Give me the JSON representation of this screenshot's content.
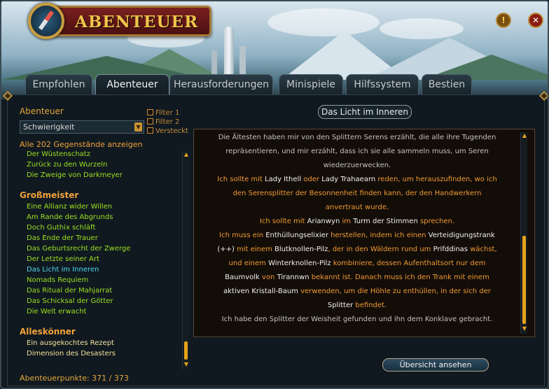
{
  "window": {
    "title": "ABENTEUER",
    "info_icon": "info-icon",
    "close_icon": "close-icon"
  },
  "tabs": [
    {
      "label": "Empfohlen",
      "active": false
    },
    {
      "label": "Abenteuer",
      "active": true
    },
    {
      "label": "Herausforderungen",
      "active": false
    },
    {
      "label": "Minispiele",
      "active": false
    },
    {
      "label": "Hilfssystem",
      "active": false
    },
    {
      "label": "Bestien",
      "active": false
    }
  ],
  "sidebar": {
    "section_title": "Abenteuer",
    "sort_dropdown": {
      "selected": "Schwierigkeit"
    },
    "filters": [
      {
        "label": "Filter 1",
        "checked": false
      },
      {
        "label": "Filter 2",
        "checked": false
      },
      {
        "label": "Versteckt",
        "checked": false
      }
    ],
    "show_all_label": "Alle 202 Gegenstände anzeigen",
    "items_top": [
      "Der Wüstenschatz",
      "Zurück zu den Wurzeln",
      "Die Zweige von Darkmeyer"
    ],
    "group_grossmeister": "Großmeister",
    "items_grossmeister": [
      "Eine Allianz wider Willen",
      "Am Rande des Abgrunds",
      "Doch Guthix schläft",
      "Das Ende der Trauer",
      "Das Geburtsrecht der Zwerge",
      "Der Letzte seiner Art",
      "Das Licht im Inneren",
      "Nomads Requiem",
      "Das Ritual der Mahjarrat",
      "Das Schicksal der Götter",
      "Die Welt erwacht"
    ],
    "current_item": "Das Licht im Inneren",
    "group_alleskoenner": "Alleskönner",
    "items_alleskoenner": [
      "Ein ausgekochtes Rezept",
      "Dimension des Desasters"
    ],
    "points": "Abenteuerpunkte: 371 / 373"
  },
  "journal": {
    "quest_title": "Das Licht im Inneren",
    "lines": [
      [
        {
          "t": "Die Ältesten haben mir von den Splittern Serens erzählt, die alle ihre Tugenden",
          "c": "g"
        }
      ],
      [
        {
          "t": "repräsentieren, und mir erzählt, dass ich sie alle sammeln muss, um Seren",
          "c": "g"
        }
      ],
      [
        {
          "t": "wiederzuerwecken.",
          "c": "g"
        }
      ],
      [
        {
          "t": "Ich sollte mit ",
          "c": "o"
        },
        {
          "t": "Lady Ithell",
          "c": "w"
        },
        {
          "t": " oder ",
          "c": "o"
        },
        {
          "t": "Lady Trahaearn",
          "c": "w"
        },
        {
          "t": " reden, um herauszufinden, wo ich",
          "c": "o"
        }
      ],
      [
        {
          "t": "den Serensplitter der Besonnenheit finden kann, der den Handwerkern",
          "c": "o"
        }
      ],
      [
        {
          "t": "anvertraut wurde.",
          "c": "o"
        }
      ],
      [
        {
          "t": "Ich sollte mit ",
          "c": "o"
        },
        {
          "t": "Arianwyn",
          "c": "w"
        },
        {
          "t": " im ",
          "c": "o"
        },
        {
          "t": "Turm der Stimmen",
          "c": "w"
        },
        {
          "t": " sprechen.",
          "c": "o"
        }
      ],
      [
        {
          "t": "Ich muss ein ",
          "c": "o"
        },
        {
          "t": "Enthüllungselixier",
          "c": "w"
        },
        {
          "t": " herstellen, indem ich einen ",
          "c": "o"
        },
        {
          "t": "Verteidigungstrank",
          "c": "w"
        }
      ],
      [
        {
          "t": "(++)",
          "c": "w"
        },
        {
          "t": " mit einem ",
          "c": "o"
        },
        {
          "t": "Blutknollen-Pilz",
          "c": "w"
        },
        {
          "t": ", der in den Wäldern rund um ",
          "c": "o"
        },
        {
          "t": "Prifddinas",
          "c": "w"
        },
        {
          "t": " wächst,",
          "c": "o"
        }
      ],
      [
        {
          "t": "und einem ",
          "c": "o"
        },
        {
          "t": "Winterknollen-Pilz",
          "c": "w"
        },
        {
          "t": " kombiniere, dessen Aufenthaltsort nur dem",
          "c": "o"
        }
      ],
      [
        {
          "t": "Baumvolk",
          "c": "w"
        },
        {
          "t": " von ",
          "c": "o"
        },
        {
          "t": "Tirannwn",
          "c": "w"
        },
        {
          "t": " bekannt ist. Danach muss ich den Trank mit einem",
          "c": "o"
        }
      ],
      [
        {
          "t": "aktiven Kristall-Baum",
          "c": "w"
        },
        {
          "t": " verwenden, um die Höhle zu enthüllen, in der sich der",
          "c": "o"
        }
      ],
      [
        {
          "t": "Splitter",
          "c": "w"
        },
        {
          "t": " befindet.",
          "c": "o"
        }
      ],
      [
        {
          "t": "Ich habe den Splitter der Weisheit gefunden und ihn dem Konklave gebracht.",
          "c": "g"
        }
      ]
    ]
  },
  "overview_button": "Übersicht ansehen",
  "colors": {
    "accent_orange": "#f2a23a",
    "list_green": "#9be020",
    "list_current": "#4fd7f0",
    "title_gold": "#f0c24a"
  }
}
